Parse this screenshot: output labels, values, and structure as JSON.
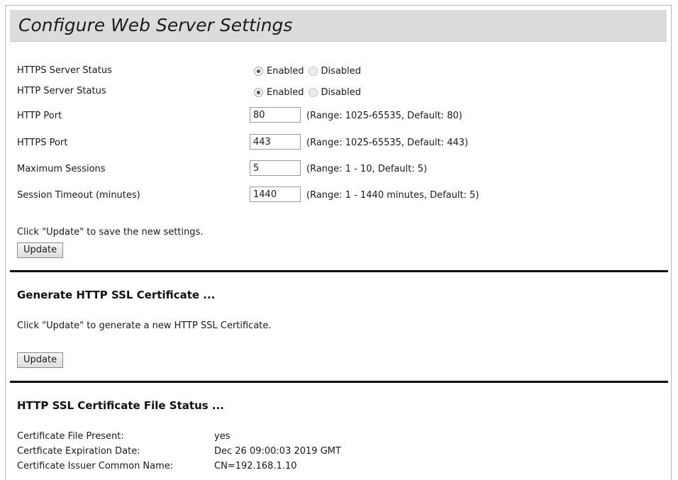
{
  "page": {
    "title": "Configure Web Server Settings"
  },
  "server": {
    "https_status": {
      "label": "HTTPS Server Status",
      "enabled_label": "Enabled",
      "disabled_label": "Disabled",
      "selected": "Enabled"
    },
    "http_status": {
      "label": "HTTP Server Status",
      "enabled_label": "Enabled",
      "disabled_label": "Disabled",
      "selected": "Enabled"
    },
    "http_port": {
      "label": "HTTP Port",
      "value": "80",
      "hint": "(Range: 1025-65535, Default: 80)"
    },
    "https_port": {
      "label": "HTTPS Port",
      "value": "443",
      "hint": "(Range: 1025-65535, Default: 443)"
    },
    "max_sessions": {
      "label": "Maximum Sessions",
      "value": "5",
      "hint": "(Range: 1 - 10, Default: 5)"
    },
    "session_timeout": {
      "label": "Session Timeout (minutes)",
      "value": "1440",
      "hint": "(Range: 1 - 1440 minutes, Default: 5)"
    },
    "instruction": "Click \"Update\" to save the new settings.",
    "update_label": "Update"
  },
  "ssl_generate": {
    "heading": "Generate HTTP SSL Certificate ...",
    "instruction": "Click \"Update\" to generate a new HTTP SSL Certificate.",
    "update_label": "Update"
  },
  "ssl_status": {
    "heading": "HTTP SSL Certificate File Status ...",
    "rows": [
      {
        "label": "Certificate File Present:",
        "value": "yes"
      },
      {
        "label": "Certficate Expiration Date:",
        "value": "Dec 26 09:00:03 2019 GMT"
      },
      {
        "label": "Certificate Issuer Common Name:",
        "value": "CN=192.168.1.10"
      }
    ]
  }
}
